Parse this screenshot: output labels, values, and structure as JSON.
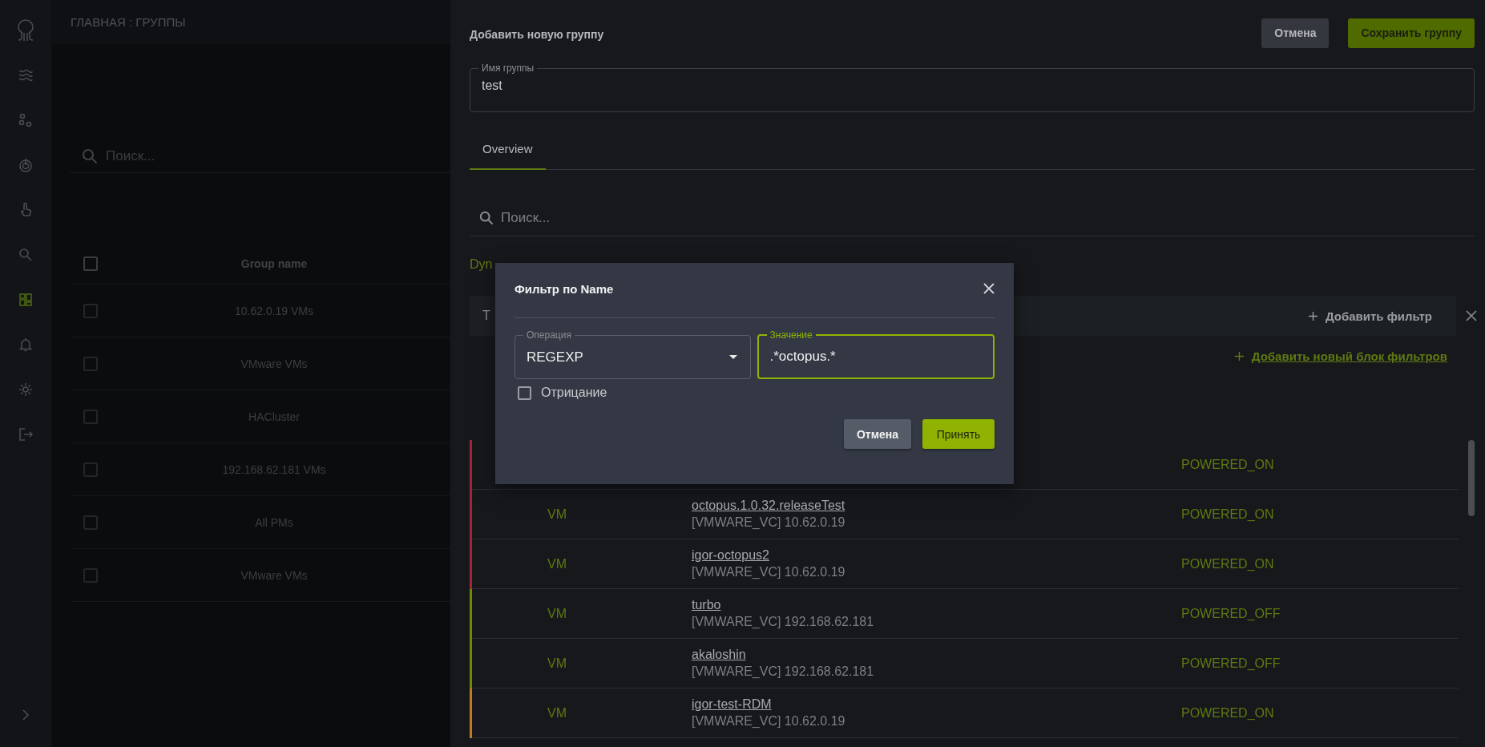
{
  "sidebar": {
    "items": [
      {
        "selected": false
      },
      {
        "selected": false
      },
      {
        "selected": false
      },
      {
        "selected": false
      },
      {
        "selected": false
      },
      {
        "selected": true
      },
      {
        "selected": false
      },
      {
        "selected": false
      },
      {
        "selected": false
      }
    ]
  },
  "background_page": {
    "title": "ГЛАВНАЯ : ГРУППЫ",
    "search": {
      "placeholder": "Поиск..."
    },
    "table": {
      "columns": [
        "Group name"
      ],
      "header_checked": false,
      "rows": [
        {
          "name": "10.62.0.19 VMs",
          "checked": false
        },
        {
          "name": "VMware VMs",
          "checked": false
        },
        {
          "name": "HACluster",
          "checked": false
        },
        {
          "name": "192.168.62.181 VMs",
          "checked": false
        },
        {
          "name": "All PMs",
          "checked": false
        },
        {
          "name": "VMware VMs",
          "checked": false
        }
      ]
    }
  },
  "panel": {
    "title": "Добавить новую группу",
    "buttons": [
      {
        "label": "Отмена",
        "kind": "secondary"
      },
      {
        "label": "Сохранить группу",
        "kind": "primary"
      }
    ],
    "name_field": {
      "label": "Имя группы",
      "value": "test"
    },
    "tabs": [
      {
        "label": "Overview",
        "selected": true
      }
    ],
    "search": {
      "placeholder": "Поиск..."
    },
    "section_label": "Dyn",
    "filter_block": {
      "text": "T",
      "add_filter": "Добавить фильтр"
    },
    "add_block_link": "Добавить новый блок фильтров",
    "rows": [
      {
        "color": "#a3253a",
        "status": "POWERED_ON"
      },
      {
        "color": "#a3253a",
        "type": "VM",
        "name": "octopus.1.0.32.releaseTest",
        "source": "[VMWARE_VC] 10.62.0.19",
        "status": "POWERED_ON"
      },
      {
        "color": "#a3253a",
        "type": "VM",
        "name": "igor-octopus2",
        "source": "[VMWARE_VC] 10.62.0.19",
        "status": "POWERED_ON"
      },
      {
        "color": "#6b8e00",
        "type": "VM",
        "name": "turbo",
        "source": "[VMWARE_VC] 192.168.62.181",
        "status": "POWERED_OFF"
      },
      {
        "color": "#6b8e00",
        "type": "VM",
        "name": "akaloshin",
        "source": "[VMWARE_VC] 192.168.62.181",
        "status": "POWERED_OFF"
      },
      {
        "color": "#c07a1f",
        "type": "VM",
        "name": "igor-test-RDM",
        "source": "[VMWARE_VC] 10.62.0.19",
        "status": "POWERED_ON"
      }
    ]
  },
  "modal": {
    "title": "Фильтр по Name",
    "operation": {
      "label": "Операция",
      "value": "REGEXP"
    },
    "value_field": {
      "label": "Значение",
      "value": ".*octopus.*",
      "focused": true
    },
    "negation": {
      "label": "Отрицание",
      "checked": false
    },
    "buttons": [
      {
        "label": "Отмена",
        "kind": "secondary"
      },
      {
        "label": "Принять",
        "kind": "primary"
      }
    ]
  }
}
